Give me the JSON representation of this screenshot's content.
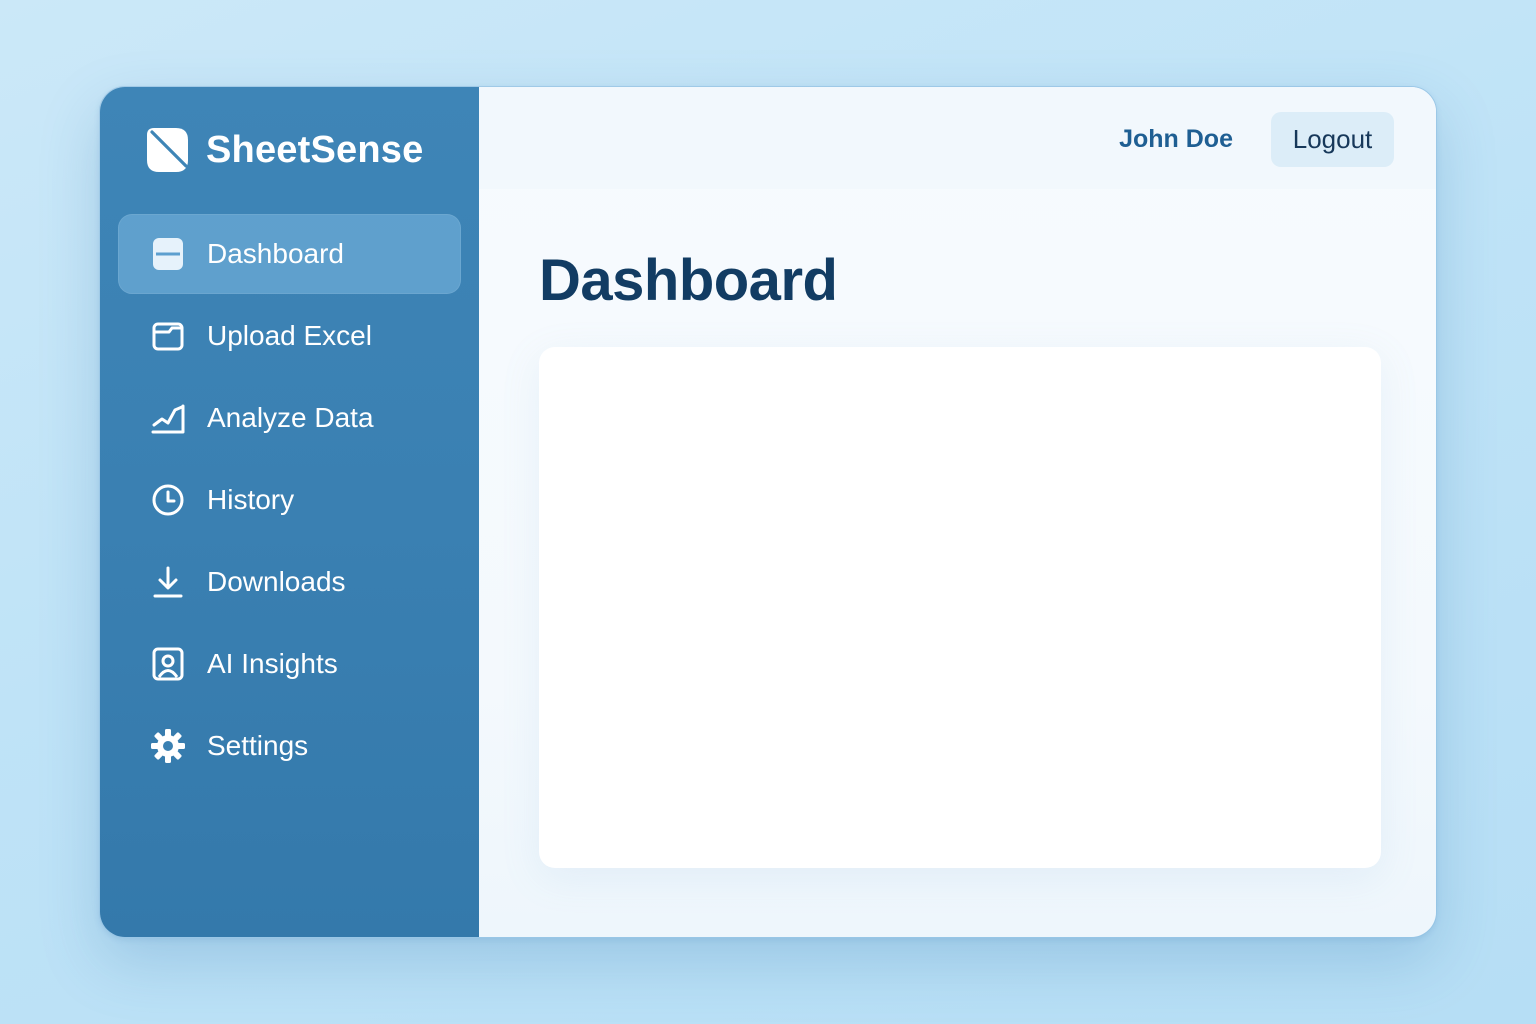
{
  "brand": {
    "name": "SheetSense",
    "logo_icon": "leaf-logo-icon"
  },
  "sidebar": {
    "items": [
      {
        "label": "Dashboard",
        "icon": "dashboard-icon",
        "active": true
      },
      {
        "label": "Upload Excel",
        "icon": "folder-icon",
        "active": false
      },
      {
        "label": "Analyze Data",
        "icon": "chart-line-icon",
        "active": false
      },
      {
        "label": "History",
        "icon": "clock-icon",
        "active": false
      },
      {
        "label": "Downloads",
        "icon": "download-icon",
        "active": false
      },
      {
        "label": "AI Insights",
        "icon": "profile-frame-icon",
        "active": false
      },
      {
        "label": "Settings",
        "icon": "gear-icon",
        "active": false
      }
    ]
  },
  "header": {
    "user_name": "John Doe",
    "logout_label": "Logout"
  },
  "main": {
    "title": "Dashboard"
  },
  "colors": {
    "sidebar_bg": "#3a80b2",
    "active_item_bg": "#5c9fcf",
    "title_text": "#123c63",
    "user_name_text": "#1f5f93",
    "logout_bg": "#dcedf8",
    "page_bg": "#c4e5f7"
  }
}
